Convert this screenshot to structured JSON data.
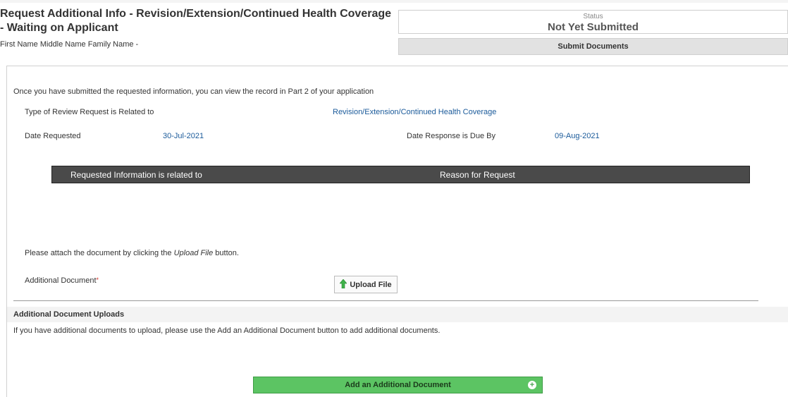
{
  "header": {
    "title": "Request Additional Info - Revision/Extension/Continued Health Coverage - Waiting on Applicant",
    "applicant_name": "First Name Middle Name Family Name -"
  },
  "status": {
    "label": "Status",
    "value": "Not Yet Submitted"
  },
  "actions": {
    "submit_label": "Submit Documents",
    "upload_label": "Upload File",
    "add_document_label": "Add an Additional Document"
  },
  "info": {
    "intro": "Once you have submitted the requested information, you can view the record in Part 2 of your application",
    "review_type_label": "Type of Review Request is Related to",
    "review_type_value": "Revision/Extension/Continued Health Coverage",
    "date_requested_label": "Date Requested",
    "date_requested_value": "30-Jul-2021",
    "date_due_label": "Date Response is Due By",
    "date_due_value": "09-Aug-2021"
  },
  "grid": {
    "columns": [
      "Requested Information is related to",
      "Reason for Request"
    ]
  },
  "attach": {
    "instruction_prefix": "Please attach the document by clicking the ",
    "instruction_emphasis": "Upload File",
    "instruction_suffix": " button.",
    "field_label": "Additional Document",
    "required_mark": "*"
  },
  "additional": {
    "section_title": "Additional Document Uploads",
    "help_text": "If you have additional documents to upload, please use the Add an Additional Document button to add additional documents."
  },
  "colors": {
    "accent_green": "#5cc463",
    "link_blue": "#1a5a9a",
    "grid_header": "#4a4a4a",
    "required_red": "#d9342b"
  },
  "icons": {
    "upload": "green-up-arrow-icon",
    "add": "plus-circle-icon"
  }
}
